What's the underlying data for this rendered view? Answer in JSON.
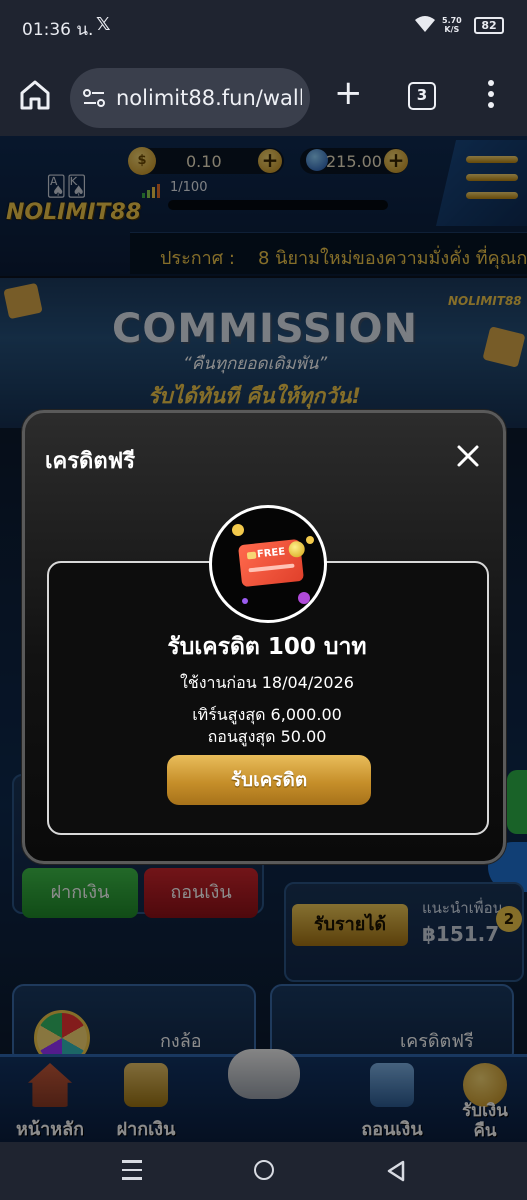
{
  "status_bar": {
    "time": "01:36 น.",
    "x_app": "𝕏",
    "net_speed_value": "5.70",
    "net_speed_unit": "K/S",
    "battery": "82"
  },
  "browser": {
    "url": "nolimit88.fun/wall",
    "tab_count": "3"
  },
  "header": {
    "logo_text": "NOLIMIT88",
    "coin_balance": "0.10",
    "gem_balance": "215.00",
    "level_text": "1/100",
    "announce_label": "ประกาศ :",
    "announce_message": "8 นิยามใหม่ของความมั่งคั่ง ที่คุณก"
  },
  "banner": {
    "title": "COMMISSION",
    "subtitle_1": "“คืนทุกยอดเดิมพัน”",
    "subtitle_2": "รับได้ทันที คืนให้ทุกวัน!",
    "mini_logo": "NOLIMIT88"
  },
  "page": {
    "deposit_label": "ฝากเงิน",
    "withdraw_label": "ถอนเงิน",
    "income_label": "รับรายได้",
    "refer_label": "แนะนำเพื่อน",
    "refer_amount": "฿151.7",
    "notif_count": "2",
    "wheel_label": "กงล้อ",
    "free_credit_label": "เครดิตฟรี"
  },
  "bottom_nav": {
    "home": "หน้าหลัก",
    "deposit": "ฝากเงิน",
    "withdraw": "ถอนเงิน",
    "cashback": "รับเงิน\nคืน"
  },
  "modal": {
    "title": "เครดิตฟรี",
    "icon_text": "FREE",
    "claim_title": "รับเครดิต 100 บาท",
    "use_before": "ใช้งานก่อน 18/04/2026",
    "max_turn": "เทิร์นสูงสุด 6,000.00",
    "max_withdraw": "ถอนสูงสุด 50.00",
    "claim_button": "รับเครดิต"
  },
  "colors": {
    "gold": "#f2c94c",
    "deposit_green": "#2fb34a",
    "withdraw_red": "#c1212a",
    "modal_bg": "#121212"
  }
}
